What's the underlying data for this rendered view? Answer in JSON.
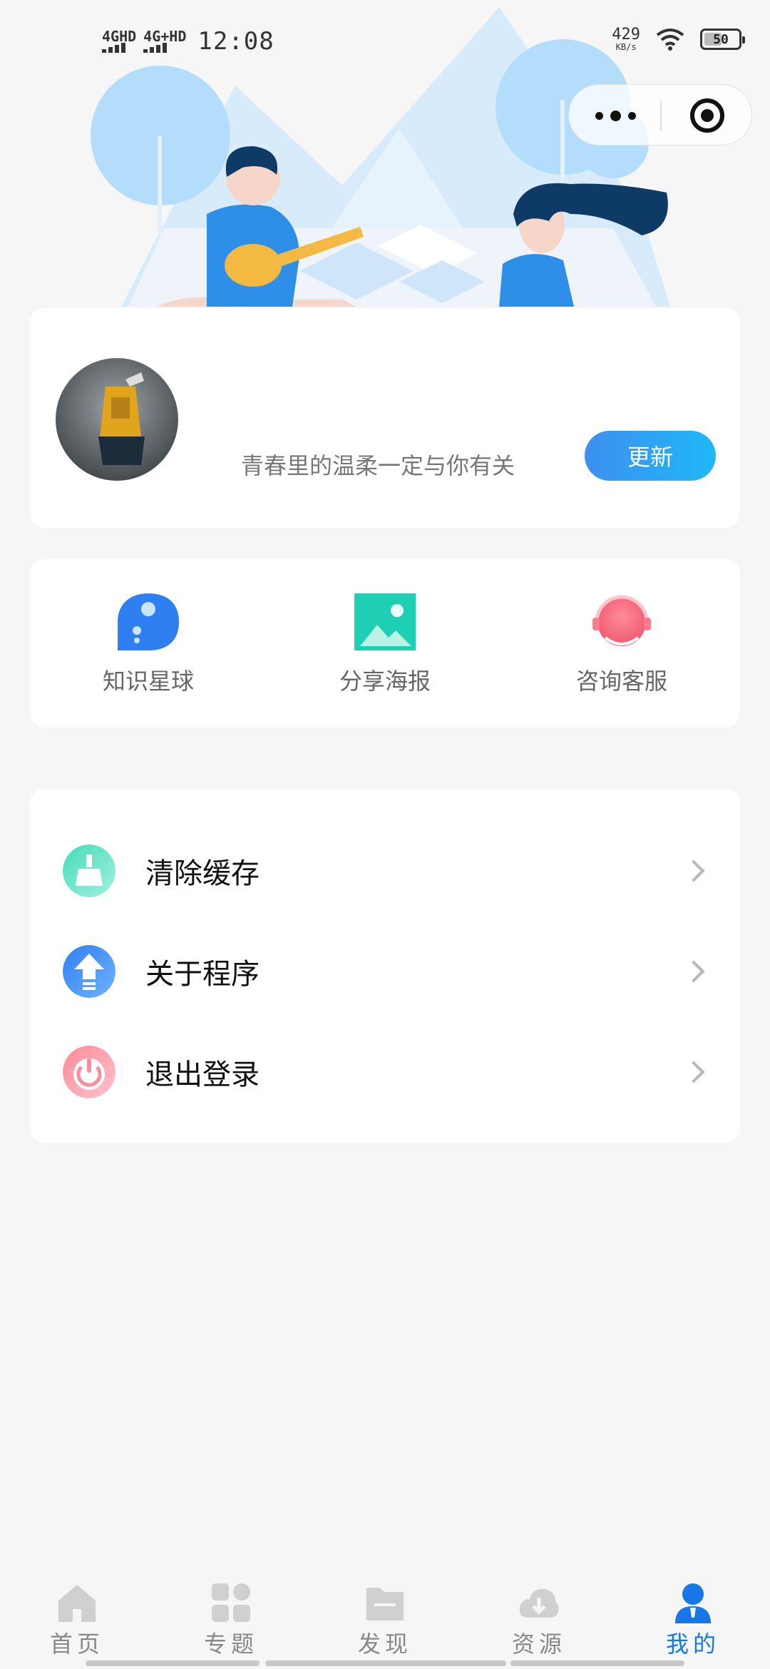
{
  "status_bar": {
    "signal1": "4GHD",
    "signal2": "4G+HD",
    "time": "12:08",
    "net_speed_value": "429",
    "net_speed_unit": "KB/s",
    "battery": "50"
  },
  "profile": {
    "motto": "青春里的温柔一定与你有关",
    "update_label": "更新"
  },
  "shortcuts": [
    {
      "label": "知识星球",
      "icon": "planet-icon"
    },
    {
      "label": "分享海报",
      "icon": "image-icon"
    },
    {
      "label": "咨询客服",
      "icon": "headset-icon"
    }
  ],
  "menu": [
    {
      "label": "清除缓存",
      "icon": "broom-icon"
    },
    {
      "label": "关于程序",
      "icon": "upload-arrow-icon"
    },
    {
      "label": "退出登录",
      "icon": "power-icon"
    }
  ],
  "tabs": [
    {
      "label": "首页",
      "icon": "home-icon",
      "active": false
    },
    {
      "label": "专题",
      "icon": "grid-icon",
      "active": false
    },
    {
      "label": "发现",
      "icon": "folder-icon",
      "active": false
    },
    {
      "label": "资源",
      "icon": "cloud-download-icon",
      "active": false
    },
    {
      "label": "我的",
      "icon": "user-icon",
      "active": true
    }
  ],
  "colors": {
    "accent": "#1677e6",
    "update_gradient_start": "#3e8ff0",
    "update_gradient_end": "#1fb8f6"
  }
}
